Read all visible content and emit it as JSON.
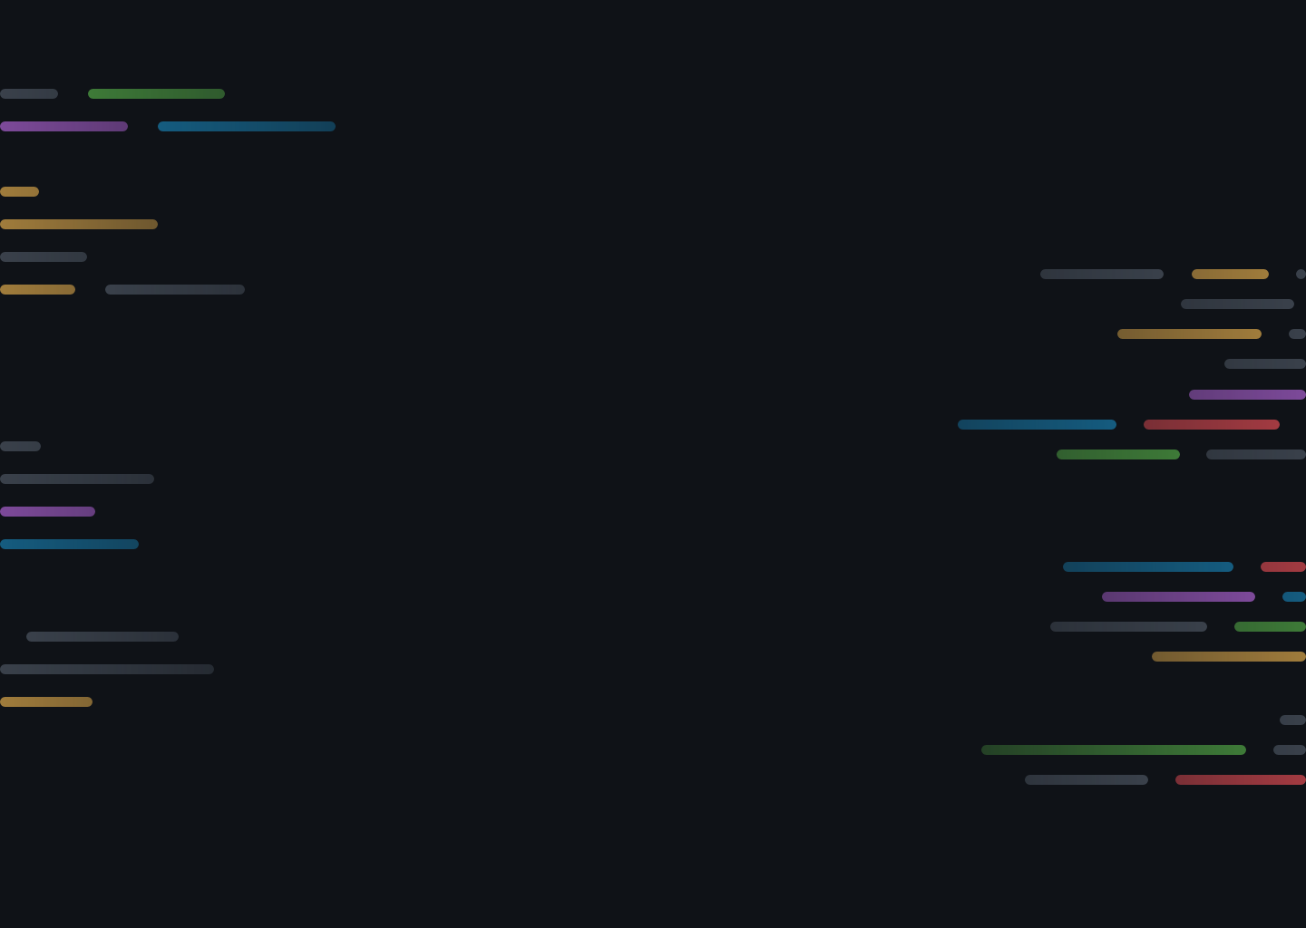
{
  "background": "#0f1217",
  "palette": {
    "gray": "#3a414b",
    "green": "#3e7a38",
    "purple": "#7d4a9a",
    "blue": "#155c80",
    "gold": "#a07c3c",
    "red": "#a33b42"
  }
}
